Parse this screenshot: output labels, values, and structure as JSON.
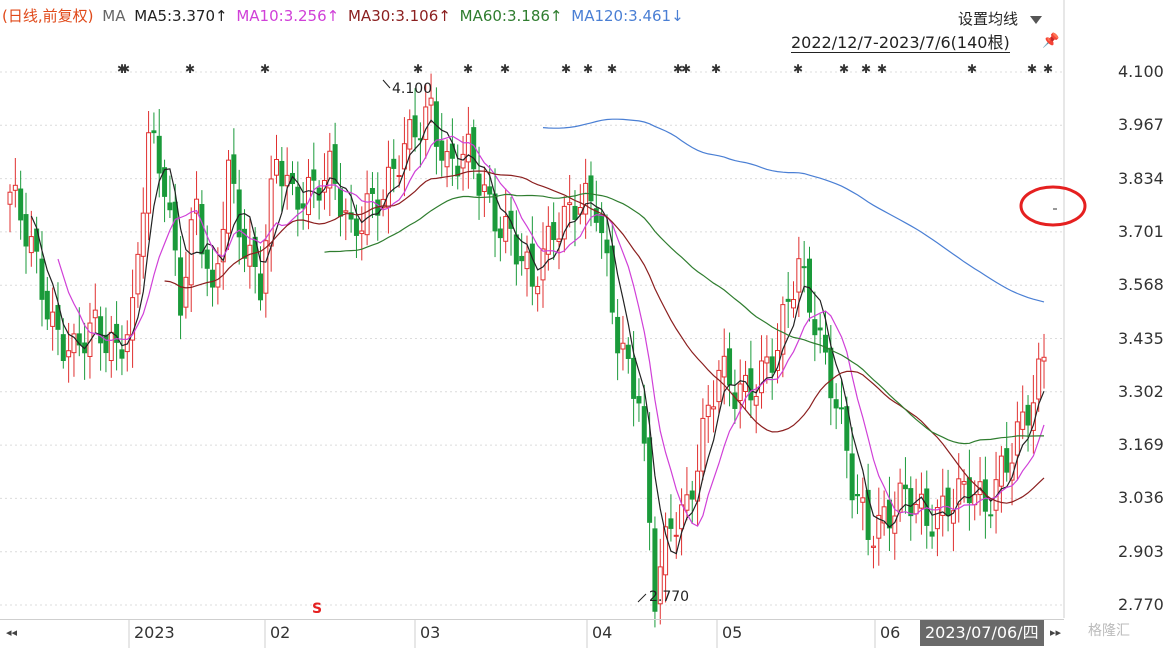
{
  "header": {
    "period": "(日线,前复权)",
    "ma_label": "MA",
    "ma5": "MA5:3.370↑",
    "ma10": "MA10:3.256↑",
    "ma30": "MA30:3.106↑",
    "ma60": "MA60:3.186↑",
    "ma120": "MA120:3.461↓"
  },
  "toolbar": {
    "settings_label": "设置均线"
  },
  "range_label": "2022/12/7-2023/7/6(140根)",
  "cursor_date": "2023/07/06/四",
  "signal_marker": "S",
  "watermark": "格隆汇",
  "nav": {
    "left": "◂◂",
    "right": "▸▸"
  },
  "colors": {
    "up": "#e03030",
    "down": "#1a9a3a",
    "ma5": "#222222",
    "ma10": "#d040d8",
    "ma30": "#8b1f1f",
    "ma60": "#2f7d2f",
    "ma120": "#4a7fd4",
    "highlight": "#e52020"
  },
  "chart_data": {
    "type": "candlestick",
    "ylim": [
      2.75,
      4.12
    ],
    "y_ticks": [
      "4.100",
      "3.967",
      "3.834",
      "3.701",
      "3.568",
      "3.435",
      "3.302",
      "3.169",
      "3.036",
      "2.903",
      "2.770"
    ],
    "x_labels": [
      "2023",
      "02",
      "03",
      "04",
      "05",
      "06"
    ],
    "annotations": [
      {
        "label": "4.100",
        "type": "high"
      },
      {
        "label": "2.770",
        "type": "low"
      }
    ],
    "last_values": {
      "ma5": 3.37,
      "ma10": 3.256,
      "ma30": 3.106,
      "ma60": 3.186,
      "ma120": 3.461
    },
    "close_anchors": [
      [
        0,
        3.8
      ],
      [
        4,
        3.65
      ],
      [
        8,
        3.48
      ],
      [
        12,
        3.4
      ],
      [
        16,
        3.45
      ],
      [
        20,
        3.42
      ],
      [
        23,
        3.5
      ],
      [
        26,
        3.92
      ],
      [
        29,
        3.82
      ],
      [
        32,
        3.55
      ],
      [
        35,
        3.78
      ],
      [
        38,
        3.5
      ],
      [
        41,
        3.85
      ],
      [
        44,
        3.68
      ],
      [
        47,
        3.58
      ],
      [
        50,
        3.87
      ],
      [
        53,
        3.78
      ],
      [
        56,
        3.82
      ],
      [
        60,
        3.85
      ],
      [
        64,
        3.68
      ],
      [
        67,
        3.78
      ],
      [
        71,
        3.82
      ],
      [
        75,
        3.92
      ],
      [
        79,
        4.02
      ],
      [
        82,
        3.87
      ],
      [
        86,
        3.88
      ],
      [
        90,
        3.77
      ],
      [
        94,
        3.7
      ],
      [
        98,
        3.55
      ],
      [
        102,
        3.72
      ],
      [
        106,
        3.78
      ],
      [
        110,
        3.75
      ],
      [
        114,
        3.45
      ],
      [
        118,
        3.3
      ],
      [
        121,
        2.78
      ],
      [
        124,
        2.97
      ],
      [
        127,
        3.03
      ],
      [
        130,
        3.2
      ],
      [
        133,
        3.34
      ],
      [
        136,
        3.3
      ],
      [
        140,
        3.34
      ],
      [
        144,
        3.4
      ],
      [
        148,
        3.62
      ],
      [
        151,
        3.5
      ],
      [
        155,
        3.27
      ],
      [
        158,
        3.06
      ],
      [
        161,
        2.96
      ],
      [
        164,
        3.0
      ],
      [
        168,
        3.03
      ],
      [
        172,
        2.98
      ],
      [
        176,
        3.04
      ],
      [
        180,
        3.05
      ],
      [
        183,
        3.0
      ],
      [
        186,
        3.12
      ],
      [
        189,
        3.2
      ],
      [
        192,
        3.27
      ],
      [
        194,
        3.37
      ]
    ]
  }
}
